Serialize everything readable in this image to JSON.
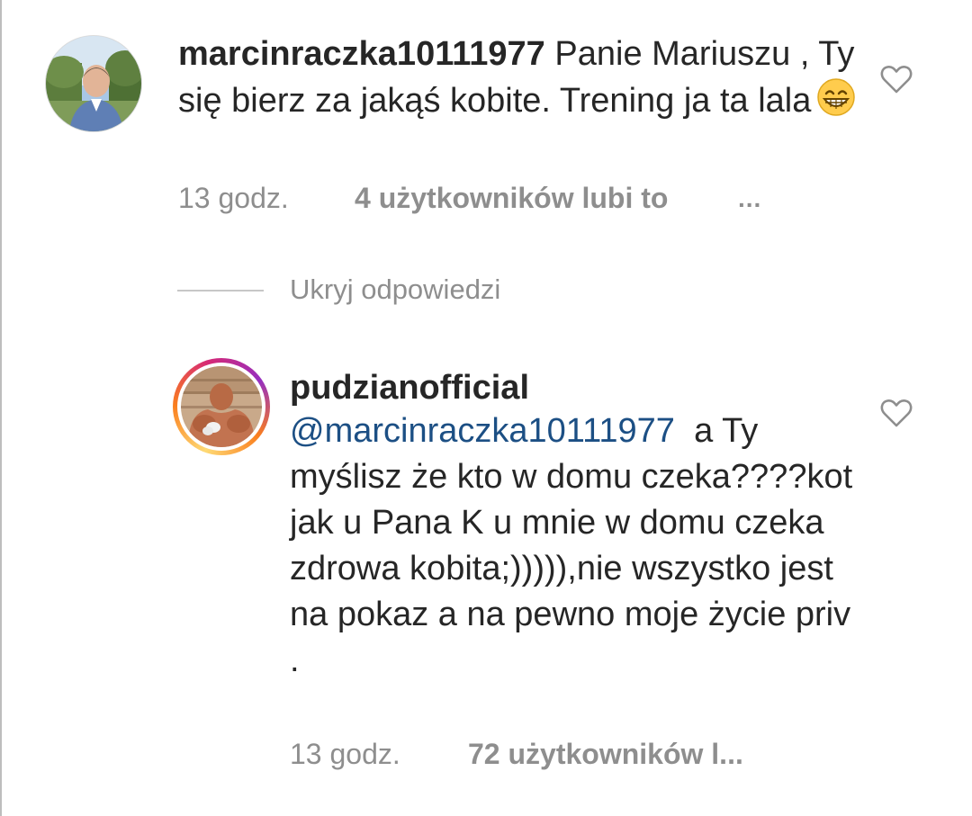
{
  "comments": [
    {
      "username": "marcinraczka10111977",
      "text": "Panie Mariuszu , Ty się  bierz  za jakąś  kobite. Trening ja ta lala",
      "emoji": "grinning-face-with-smiling-eyes",
      "time": "13 godz.",
      "likes": "4 użytkowników lubi to",
      "more": "..."
    }
  ],
  "replies_toggle": "Ukryj odpowiedzi",
  "reply": {
    "username": "pudzianofficial",
    "mention": "@marcinraczka10111977",
    "text": "a Ty myślisz że kto w domu czeka????kot jak u Pana  K  u mnie w domu  czeka  zdrowa kobita;))))),nie wszystko jest na pokaz a na pewno moje życie priv .",
    "time": "13 godz.",
    "likes": "72 użytkowników l..."
  },
  "icons": {
    "like": "heart-outline-icon",
    "more": "more-dots-icon"
  },
  "colors": {
    "mention": "#1c4f84",
    "meta": "#8e8e8e",
    "text": "#262626"
  }
}
